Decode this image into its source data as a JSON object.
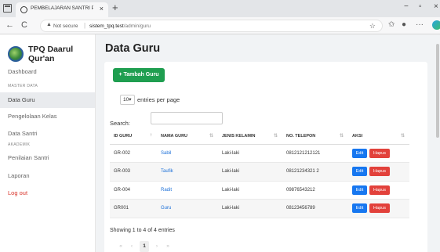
{
  "browser": {
    "tab_title": "PEMBELAJARAN SANTRI PADA TI",
    "tab_close": "×",
    "new_tab": "+",
    "back": "←",
    "reload": "C",
    "not_secure": "Not secure",
    "url_host": "sistem_tpq.test",
    "url_path": "/admin/guru",
    "window_controls": {
      "minimize": "−",
      "maximize": "▫",
      "close": "×"
    },
    "toolbar_icons": [
      "star-icon",
      "favorites-icon",
      "profile-icon",
      "more-icon",
      "edge-icon"
    ]
  },
  "sidebar": {
    "brand": "TPQ Daarul Qur'an",
    "items": [
      {
        "label": "Dashboard"
      },
      {
        "section": "MASTER DATA"
      },
      {
        "label": "Data Guru",
        "active": true
      },
      {
        "label": "Pengelolaan Kelas"
      },
      {
        "label": "Data Santri"
      },
      {
        "section": "AKADEMIK"
      },
      {
        "label": "Penilaian Santri"
      },
      {
        "label": "Laporan"
      },
      {
        "label": "Log out"
      }
    ]
  },
  "main": {
    "title": "Data Guru",
    "add_button": "+ Tambah Guru",
    "entries_value": "10",
    "entries_label": "entries per page",
    "search_label": "Search:",
    "table": {
      "columns": [
        "ID GURU",
        "NAMA GURU",
        "JENIS KELAMIN",
        "NO. TELEPON",
        "AKSI"
      ],
      "rows": [
        [
          "GR-002",
          "Sabil",
          "Laki-laki",
          "0812121212121"
        ],
        [
          "GR-003",
          "Taufik",
          "Laki-laki",
          "08121234321 2"
        ],
        [
          "GR-004",
          "Radit",
          "Laki-laki",
          "09876543212"
        ],
        [
          "GR001",
          "Guru",
          "Laki-laki",
          "08123456789"
        ]
      ],
      "edit_label": "Edit",
      "delete_label": "Hapus"
    },
    "info": "Showing 1 to 4 of 4 entries",
    "pagination": {
      "first": "«",
      "prev": "‹",
      "current": "1",
      "next": "›",
      "last": "»"
    }
  },
  "colors": {
    "add": "#1f9e50",
    "edit": "#1777f0",
    "delete": "#e2413b",
    "logout": "#d9342b",
    "link": "#1a6fd8"
  }
}
